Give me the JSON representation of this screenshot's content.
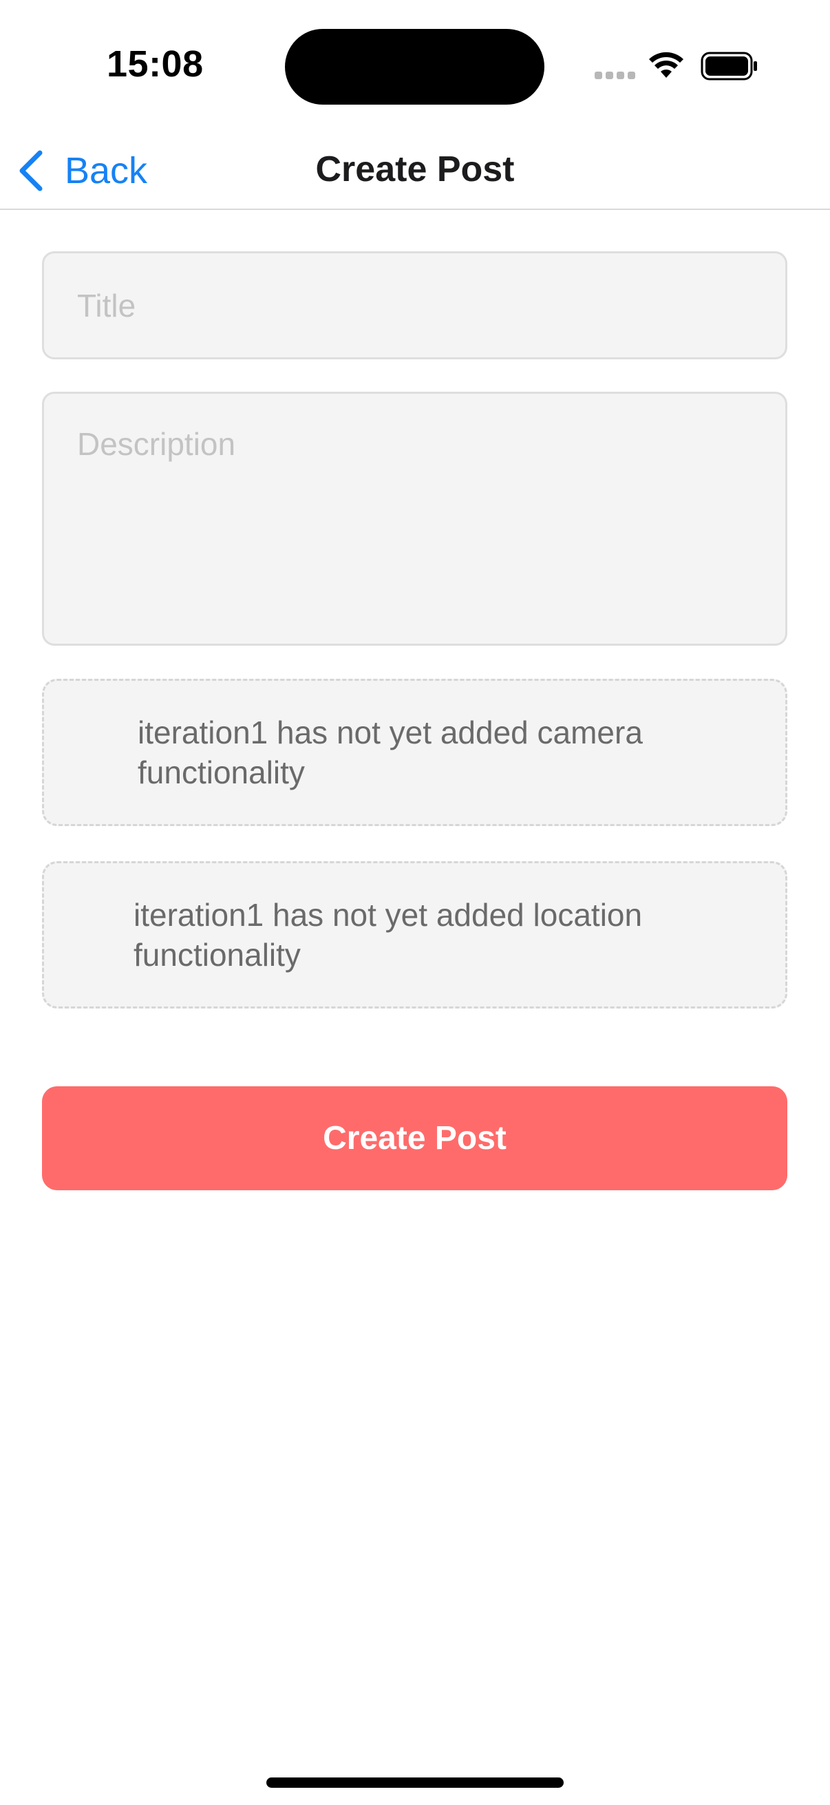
{
  "status_bar": {
    "time": "15:08",
    "icons": [
      "signal-dots-icon",
      "wifi-icon",
      "battery-icon"
    ]
  },
  "nav": {
    "back_label": "Back",
    "title": "Create Post",
    "accent_color": "#1682f5"
  },
  "form": {
    "title_placeholder": "Title",
    "title_value": "",
    "description_placeholder": "Description",
    "description_value": "",
    "camera_notice": "iteration1 has not yet added camera functionality",
    "location_notice": "iteration1 has not yet added location functionality",
    "submit_label": "Create Post",
    "submit_color": "#ff6b6b"
  }
}
